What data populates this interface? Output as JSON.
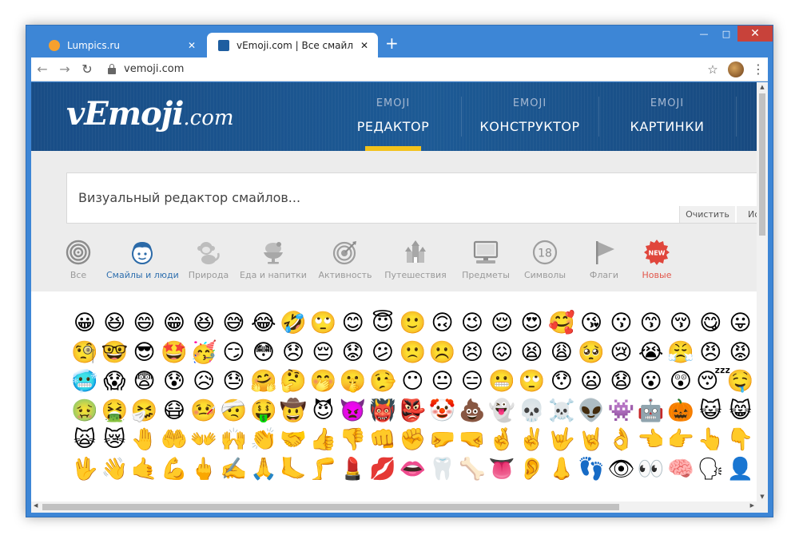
{
  "browser": {
    "tabs": [
      {
        "title": "Lumpics.ru",
        "favicon_color": "#f6a02d",
        "active": false
      },
      {
        "title": "vEmoji.com | Все смайлы ВКонта",
        "favicon_color": "#1f5ea0",
        "active": true
      }
    ],
    "new_tab": "+",
    "window_controls": {
      "minimize": "—",
      "maximize": "□",
      "close": "✕"
    },
    "back": "←",
    "forward": "→",
    "reload": "↻",
    "url": "vemoji.com",
    "bookmark": "☆",
    "menu": "⋮"
  },
  "site": {
    "logo_main": "vEmoji",
    "logo_domain": ".com",
    "nav": [
      {
        "small": "EMOJI",
        "label": "РЕДАКТОР",
        "active": true
      },
      {
        "small": "EMOJI",
        "label": "КОНСТРУКТОР",
        "active": false
      },
      {
        "small": "EMOJI",
        "label": "КАРТИНКИ",
        "active": false
      }
    ],
    "accent": "#f2c21b"
  },
  "editor": {
    "placeholder": "Визуальный редактор смайлов...",
    "clear_label": "Очистить",
    "more_label": "Ис"
  },
  "categories": [
    {
      "label": "Все",
      "icon": "spiral-icon"
    },
    {
      "label": "Смайлы и люди",
      "icon": "boy-face-icon",
      "active": true
    },
    {
      "label": "Природа",
      "icon": "monkey-icon"
    },
    {
      "label": "Еда и напитки",
      "icon": "ice-cream-icon"
    },
    {
      "label": "Активность",
      "icon": "target-icon"
    },
    {
      "label": "Путешествия",
      "icon": "castle-icon"
    },
    {
      "label": "Предметы",
      "icon": "computer-icon"
    },
    {
      "label": "Символы",
      "icon": "number-18-icon"
    },
    {
      "label": "Флаги",
      "icon": "flag-icon"
    },
    {
      "label": "Новые",
      "icon": "new-badge-icon"
    }
  ],
  "emoji_rows": [
    [
      "😀",
      "😆",
      "😄",
      "😁",
      "😆",
      "😅",
      "😂",
      "🤣",
      "🙄",
      "😊",
      "😇",
      "🙂",
      "🙃",
      "😉",
      "😌",
      "😍",
      "🥰",
      "😘",
      "😗",
      "😙",
      "😚",
      "😋",
      "😛"
    ],
    [
      "🧐",
      "🤓",
      "😎",
      "🤩",
      "🥳",
      "😏",
      "😳",
      "😞",
      "😔",
      "😟",
      "😕",
      "🙁",
      "☹️",
      "😣",
      "😖",
      "😫",
      "😩",
      "🥺",
      "😢",
      "😭",
      "😤",
      "😠",
      "😡"
    ],
    [
      "🥶",
      "😱",
      "😨",
      "😰",
      "😥",
      "😓",
      "🤗",
      "🤔",
      "🤭",
      "🤫",
      "🤥",
      "😶",
      "😐",
      "😑",
      "😬",
      "🙄",
      "😯",
      "😦",
      "😧",
      "😮",
      "😲",
      "😴",
      "🤤"
    ],
    [
      "🤢",
      "🤮",
      "🤧",
      "😷",
      "🤒",
      "🤕",
      "🤑",
      "🤠",
      "😈",
      "👿",
      "👹",
      "👺",
      "🤡",
      "💩",
      "👻",
      "💀",
      "☠️",
      "👽",
      "👾",
      "🤖",
      "🎃",
      "😺",
      "😸"
    ],
    [
      "🙀",
      "😿",
      "🤚",
      "🤲",
      "👐",
      "🙌",
      "👏",
      "🤝",
      "👍",
      "👎",
      "👊",
      "✊",
      "🤛",
      "🤜",
      "🤞",
      "✌️",
      "🤟",
      "🤘",
      "👌",
      "👈",
      "👉",
      "👆",
      "👇"
    ],
    [
      "🖖",
      "👋",
      "🤙",
      "💪",
      "🖕",
      "✍️",
      "🙏",
      "🦶",
      "🦵",
      "💄",
      "💋",
      "👄",
      "🦷",
      "🦴",
      "👅",
      "👂",
      "👃",
      "👣",
      "👁",
      "👀",
      "🧠",
      "🗣",
      "👤"
    ]
  ]
}
